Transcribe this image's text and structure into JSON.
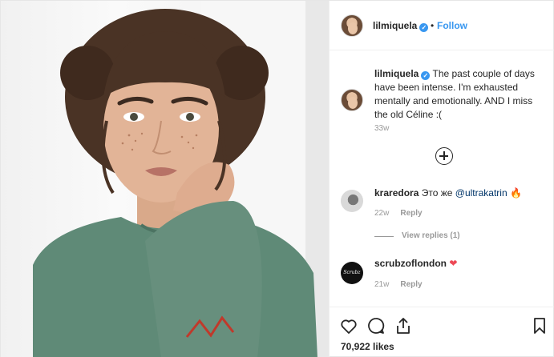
{
  "header": {
    "username": "lilmiquela",
    "separator": "•",
    "follow_label": "Follow"
  },
  "caption": {
    "username": "lilmiquela",
    "text": "The past couple of days have been intense. I'm exhausted mentally and emotionally. AND I miss the old Céline :(",
    "time": "33w"
  },
  "comments": [
    {
      "username": "kraredora",
      "text": "Это же",
      "mention": "@ultrakatrin",
      "emoji": "🔥",
      "time": "22w",
      "reply_label": "Reply",
      "view_replies": "View replies (1)"
    },
    {
      "username": "scrubzoflondon",
      "avatar_text": "Scrubz",
      "emoji": "❤",
      "time": "21w",
      "reply_label": "Reply"
    }
  ],
  "footer": {
    "likes": "70,922 likes"
  },
  "icons": [
    "heart-icon",
    "comment-icon",
    "share-icon",
    "bookmark-icon",
    "add-icon",
    "verified-icon"
  ],
  "colors": {
    "link": "#3897f0",
    "verified": "#3897f0",
    "mention": "#003569",
    "muted": "#999999"
  }
}
